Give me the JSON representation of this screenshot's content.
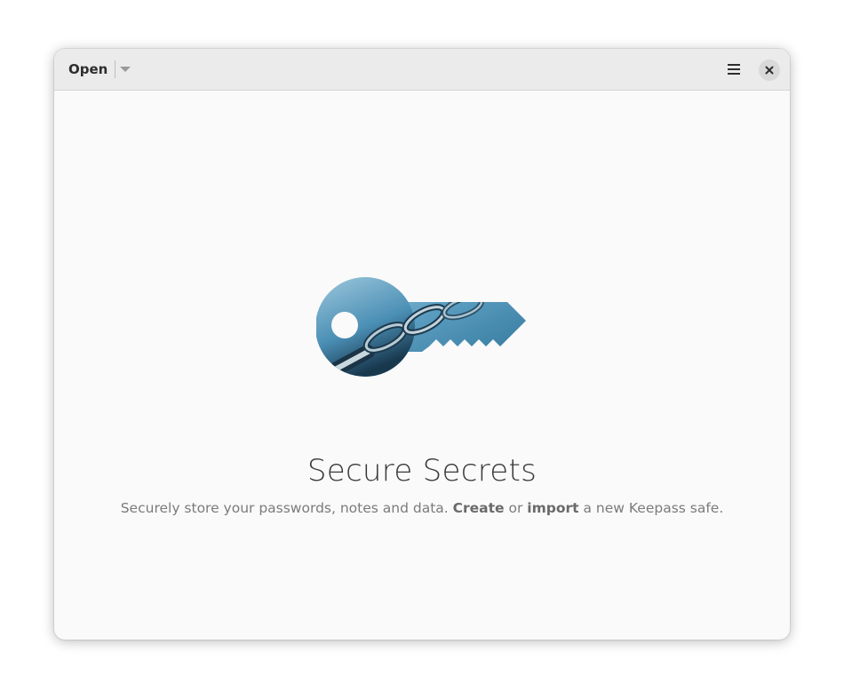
{
  "header": {
    "open_label": "Open",
    "open_dropdown_icon": "pan-down-icon",
    "menu_icon": "hamburger-menu-icon",
    "close_icon": "close-icon"
  },
  "welcome": {
    "illustration_icon": "key-illustration-icon",
    "title": "Secure Secrets",
    "subtitle_prefix": "Securely store your passwords, notes and data.",
    "create_link": "Create",
    "or_text": "or",
    "import_link": "import",
    "subtitle_suffix": "a new Keepass safe."
  },
  "colors": {
    "headerbar": "#ebebeb",
    "background": "#fafafa",
    "key_gradient_light": "#8fbfd6",
    "key_gradient_dark": "#2f7fa5"
  }
}
